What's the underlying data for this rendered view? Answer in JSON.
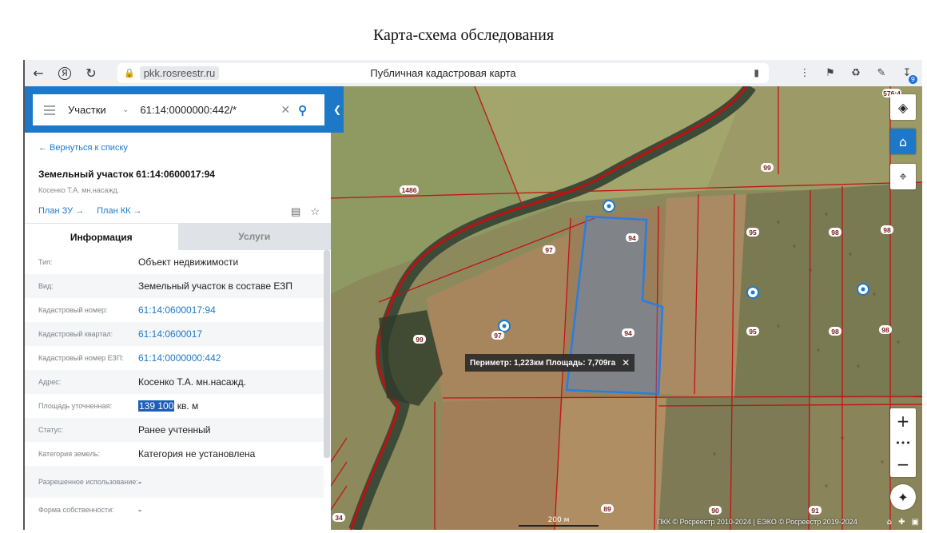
{
  "document_title": "Карта-схема обследования",
  "browser": {
    "url": "pkk.rosreestr.ru",
    "page_title": "Публичная кадастровая карта",
    "download_count": "9"
  },
  "search": {
    "category": "Участки",
    "query": "61:14:0000000:442/*"
  },
  "panel": {
    "back_link": "← Вернуться к списку",
    "title": "Земельный участок 61:14:0600017:94",
    "owner": "Косенко Т.А. мн.насажд.",
    "plan_zu": "План ЗУ →",
    "plan_kk": "План КК →",
    "tabs": [
      "Информация",
      "Услуги"
    ],
    "rows": [
      {
        "label": "Тип:",
        "value": "Объект недвижимости"
      },
      {
        "label": "Вид:",
        "value": "Земельный участок в составе ЕЗП"
      },
      {
        "label": "Кадастровый номер:",
        "value": "61:14:0600017:94"
      },
      {
        "label": "Кадастровый квартал:",
        "value": "61:14:0600017"
      },
      {
        "label": "Кадастровый номер ЕЗП:",
        "value": "61:14:0000000:442"
      },
      {
        "label": "Адрес:",
        "value": "Косенко Т.А. мн.насажд."
      },
      {
        "label": "Площадь уточненная:",
        "value_highlight": "139 100",
        "value_rest": " кв. м"
      },
      {
        "label": "Статус:",
        "value": "Ранее учтенный"
      },
      {
        "label": "Категория земель:",
        "value": "Категория не установлена"
      },
      {
        "label": "Разрешенное использование:",
        "value": "-"
      },
      {
        "label": "Форма собственности:",
        "value": "-"
      }
    ]
  },
  "map": {
    "measure": "Периметр: 1,223км Площадь: 7,709га",
    "scale": "200 м",
    "copyright": "ПКК © Росреестр 2010-2024 | ЕЭКО © Росреестр 2019-2024",
    "plot_labels": [
      "1486",
      "99",
      "97",
      "94",
      "94",
      "97",
      "99",
      "95",
      "95",
      "98",
      "98",
      "98",
      "98",
      "89",
      "90",
      "91",
      "34",
      "576:4"
    ]
  }
}
